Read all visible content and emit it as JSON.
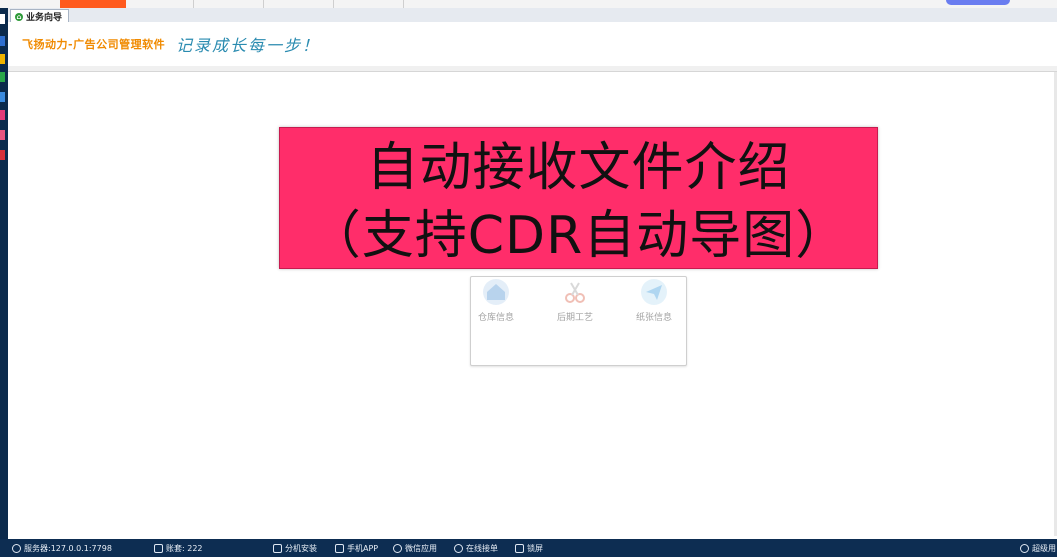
{
  "tab": {
    "label": "业务向导"
  },
  "header": {
    "brand": "飞扬动力-广告公司管理软件",
    "slogan": "记录成长每一步！"
  },
  "banner": {
    "line1": "自动接收文件介绍",
    "line2": "（支持CDR自动导图）"
  },
  "modules": [
    {
      "label": "仓库信息",
      "icon": "warehouse-icon",
      "color": "#7fb0df"
    },
    {
      "label": "后期工艺",
      "icon": "scissors-icon",
      "color": "#e58b7a"
    },
    {
      "label": "纸张信息",
      "icon": "paper-plane-icon",
      "color": "#6fb6e6"
    }
  ],
  "statusbar": {
    "server": "服务器:127.0.0.1:7798",
    "account": "账套: 222",
    "install": "分机安装",
    "mobile": "手机APP",
    "wechat": "微信应用",
    "order": "在线接单",
    "lock": "锁屏",
    "user": "超级用"
  },
  "colors": {
    "banner_bg": "#ff2d6a",
    "status_bg": "#0d2d52",
    "brand": "#f08a00"
  }
}
